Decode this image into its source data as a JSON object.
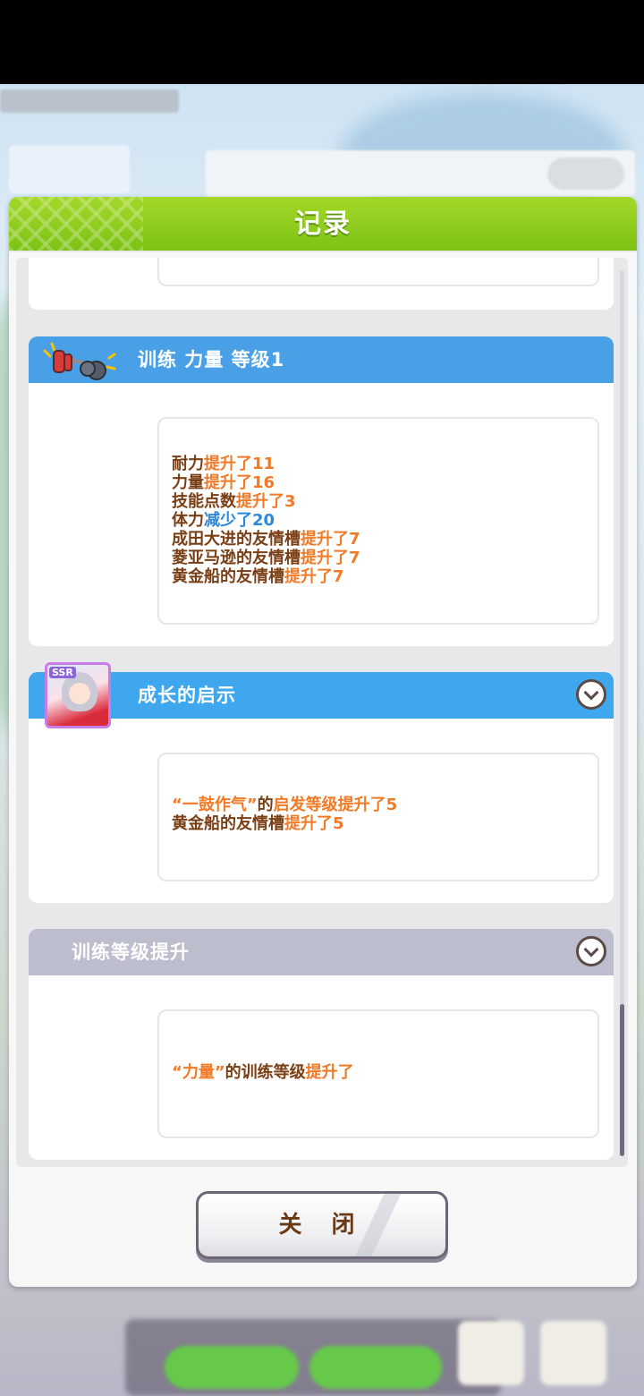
{
  "modal": {
    "title": "记录",
    "close_label": "关 闭"
  },
  "records": [
    {
      "title": "训练 力量 等级1",
      "icon": "dumbbell-icon",
      "lines": [
        {
          "parts": [
            {
              "t": "耐力",
              "s": "n"
            },
            {
              "t": "提升了11",
              "s": "up"
            }
          ]
        },
        {
          "parts": [
            {
              "t": "力量",
              "s": "n"
            },
            {
              "t": "提升了16",
              "s": "up"
            }
          ]
        },
        {
          "parts": [
            {
              "t": "技能点数",
              "s": "n"
            },
            {
              "t": "提升了3",
              "s": "up"
            }
          ]
        },
        {
          "parts": [
            {
              "t": "体力",
              "s": "n"
            },
            {
              "t": "减少了20",
              "s": "down"
            }
          ]
        },
        {
          "parts": [
            {
              "t": "成田大进的友情槽",
              "s": "n"
            },
            {
              "t": "提升了7",
              "s": "up"
            }
          ]
        },
        {
          "parts": [
            {
              "t": "菱亚马逊的友情槽",
              "s": "n"
            },
            {
              "t": "提升了7",
              "s": "up"
            }
          ]
        },
        {
          "parts": [
            {
              "t": "黄金船的友情槽",
              "s": "n"
            },
            {
              "t": "提升了7",
              "s": "up"
            }
          ]
        }
      ]
    },
    {
      "title": "成长的启示",
      "icon": "support-card-portrait",
      "badge": "SSR",
      "lines": [
        {
          "parts": [
            {
              "t": "“一鼓作气”",
              "s": "up"
            },
            {
              "t": "的",
              "s": "n"
            },
            {
              "t": "启发等级提升了5",
              "s": "up"
            }
          ]
        },
        {
          "parts": [
            {
              "t": "黄金船的友情槽",
              "s": "n"
            },
            {
              "t": "提升了5",
              "s": "up"
            }
          ]
        }
      ]
    },
    {
      "title": "训练等级提升",
      "lines": [
        {
          "parts": [
            {
              "t": "“力量”",
              "s": "up"
            },
            {
              "t": "的训练等级",
              "s": "n"
            },
            {
              "t": "提升了",
              "s": "up"
            }
          ]
        }
      ]
    }
  ],
  "colors": {
    "header_green": "#8ccc1e",
    "band_blue": "#4aa0e6",
    "band_gray": "#bcbdcd",
    "text_brown": "#7a3e14",
    "text_orange": "#f17a26",
    "text_blue": "#2e88d9"
  }
}
